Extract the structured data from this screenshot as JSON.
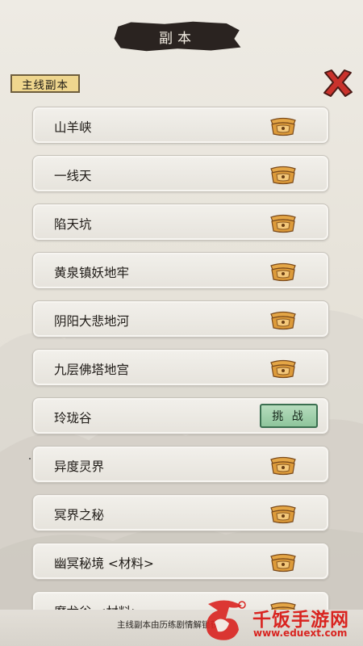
{
  "title": "副本",
  "tab_label": "主线副本",
  "dungeons": [
    {
      "name": "山羊峡",
      "state": "locked"
    },
    {
      "name": "一线天",
      "state": "locked"
    },
    {
      "name": "陷天坑",
      "state": "locked"
    },
    {
      "name": "黄泉镇妖地牢",
      "state": "locked"
    },
    {
      "name": "阴阳大悲地河",
      "state": "locked"
    },
    {
      "name": "九层佛塔地宫",
      "state": "locked"
    },
    {
      "name": "玲珑谷",
      "state": "available"
    },
    {
      "name": "异度灵界",
      "state": "locked"
    },
    {
      "name": "冥界之秘",
      "state": "locked"
    },
    {
      "name": "幽冥秘境 <材料>",
      "state": "locked"
    },
    {
      "name": "魔龙谷 <材料>",
      "state": "locked"
    }
  ],
  "challenge_label": "挑 战",
  "footer_text": "主线副本由历练剧情解锁获得",
  "watermark": {
    "name": "千饭手游网",
    "url": "www.eduext.com"
  },
  "colors": {
    "title_bg": "#2a2320",
    "tag_bg": "#efd68e",
    "lock": "#e0a23f",
    "challenge_bg": "#9fcfab",
    "close_x": "#c9322c"
  },
  "icons": {
    "close": "close-x-icon",
    "lock": "padlock-icon"
  }
}
